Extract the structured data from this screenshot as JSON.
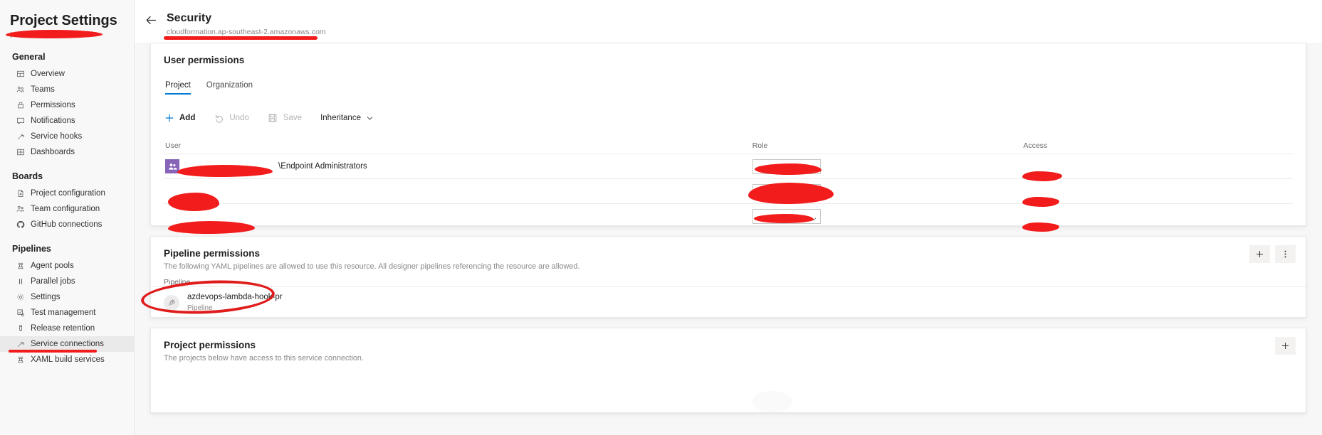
{
  "sidebar": {
    "title": "Project Settings",
    "subtitle_prefix": "P",
    "groups": [
      {
        "name": "General",
        "items": [
          {
            "label": "Overview",
            "icon": "overview-icon"
          },
          {
            "label": "Teams",
            "icon": "teams-icon"
          },
          {
            "label": "Permissions",
            "icon": "lock-icon"
          },
          {
            "label": "Notifications",
            "icon": "notification-icon"
          },
          {
            "label": "Service hooks",
            "icon": "plug-icon"
          },
          {
            "label": "Dashboards",
            "icon": "dashboard-icon"
          }
        ]
      },
      {
        "name": "Boards",
        "items": [
          {
            "label": "Project configuration",
            "icon": "document-icon"
          },
          {
            "label": "Team configuration",
            "icon": "teams-icon"
          },
          {
            "label": "GitHub connections",
            "icon": "github-icon"
          }
        ]
      },
      {
        "name": "Pipelines",
        "items": [
          {
            "label": "Agent pools",
            "icon": "agent-icon"
          },
          {
            "label": "Parallel jobs",
            "icon": "parallel-icon"
          },
          {
            "label": "Settings",
            "icon": "gear-icon"
          },
          {
            "label": "Test management",
            "icon": "test-icon"
          },
          {
            "label": "Release retention",
            "icon": "retention-icon"
          },
          {
            "label": "Service connections",
            "icon": "plug-icon",
            "active": true
          },
          {
            "label": "XAML build services",
            "icon": "agent-icon"
          }
        ]
      }
    ]
  },
  "header": {
    "title": "Security",
    "subtitle": "cloudformation.ap-southeast-2.amazonaws.com",
    "back_icon": "back-arrow-icon"
  },
  "user_permissions": {
    "heading": "User permissions",
    "tabs": [
      {
        "label": "Project",
        "selected": true
      },
      {
        "label": "Organization",
        "selected": false
      }
    ],
    "toolbar": {
      "add_label": "Add",
      "undo_label": "Undo",
      "save_label": "Save",
      "inheritance_label": "Inheritance"
    },
    "columns": [
      "User",
      "Role",
      "Access"
    ],
    "rows": [
      {
        "user": "\\Endpoint Administrators",
        "user_redacted": true,
        "role_redacted": true,
        "role_boxed": true,
        "access_redacted": true,
        "has_avatar": true
      },
      {
        "user": "",
        "user_redacted": true,
        "role_redacted": true,
        "role_boxed": true,
        "access_redacted": true,
        "has_avatar": false
      },
      {
        "user": "",
        "user_redacted": true,
        "role_redacted": true,
        "role_boxed": true,
        "access_redacted": true,
        "has_avatar": false
      }
    ]
  },
  "pipeline_permissions": {
    "heading": "Pipeline permissions",
    "description": "The following YAML pipelines are allowed to use this resource. All designer pipelines referencing the resource are allowed.",
    "column": "Pipeline",
    "rows": [
      {
        "name": "azdevops-lambda-hook-pr",
        "type": "Pipeline",
        "icon": "rocket-icon",
        "annotated": true
      }
    ],
    "actions": [
      {
        "icon": "plus-icon",
        "name": "add-pipeline-button"
      },
      {
        "icon": "more-vertical-icon",
        "name": "more-options-button"
      }
    ]
  },
  "project_permissions": {
    "heading": "Project permissions",
    "description": "The projects below have access to this service connection.",
    "actions": [
      {
        "icon": "plus-icon",
        "name": "add-project-button"
      }
    ]
  },
  "colors": {
    "accent": "#0078d4",
    "redaction": "#f21c1c",
    "annotation": "#e01b1b",
    "avatar": "#8764b8"
  }
}
